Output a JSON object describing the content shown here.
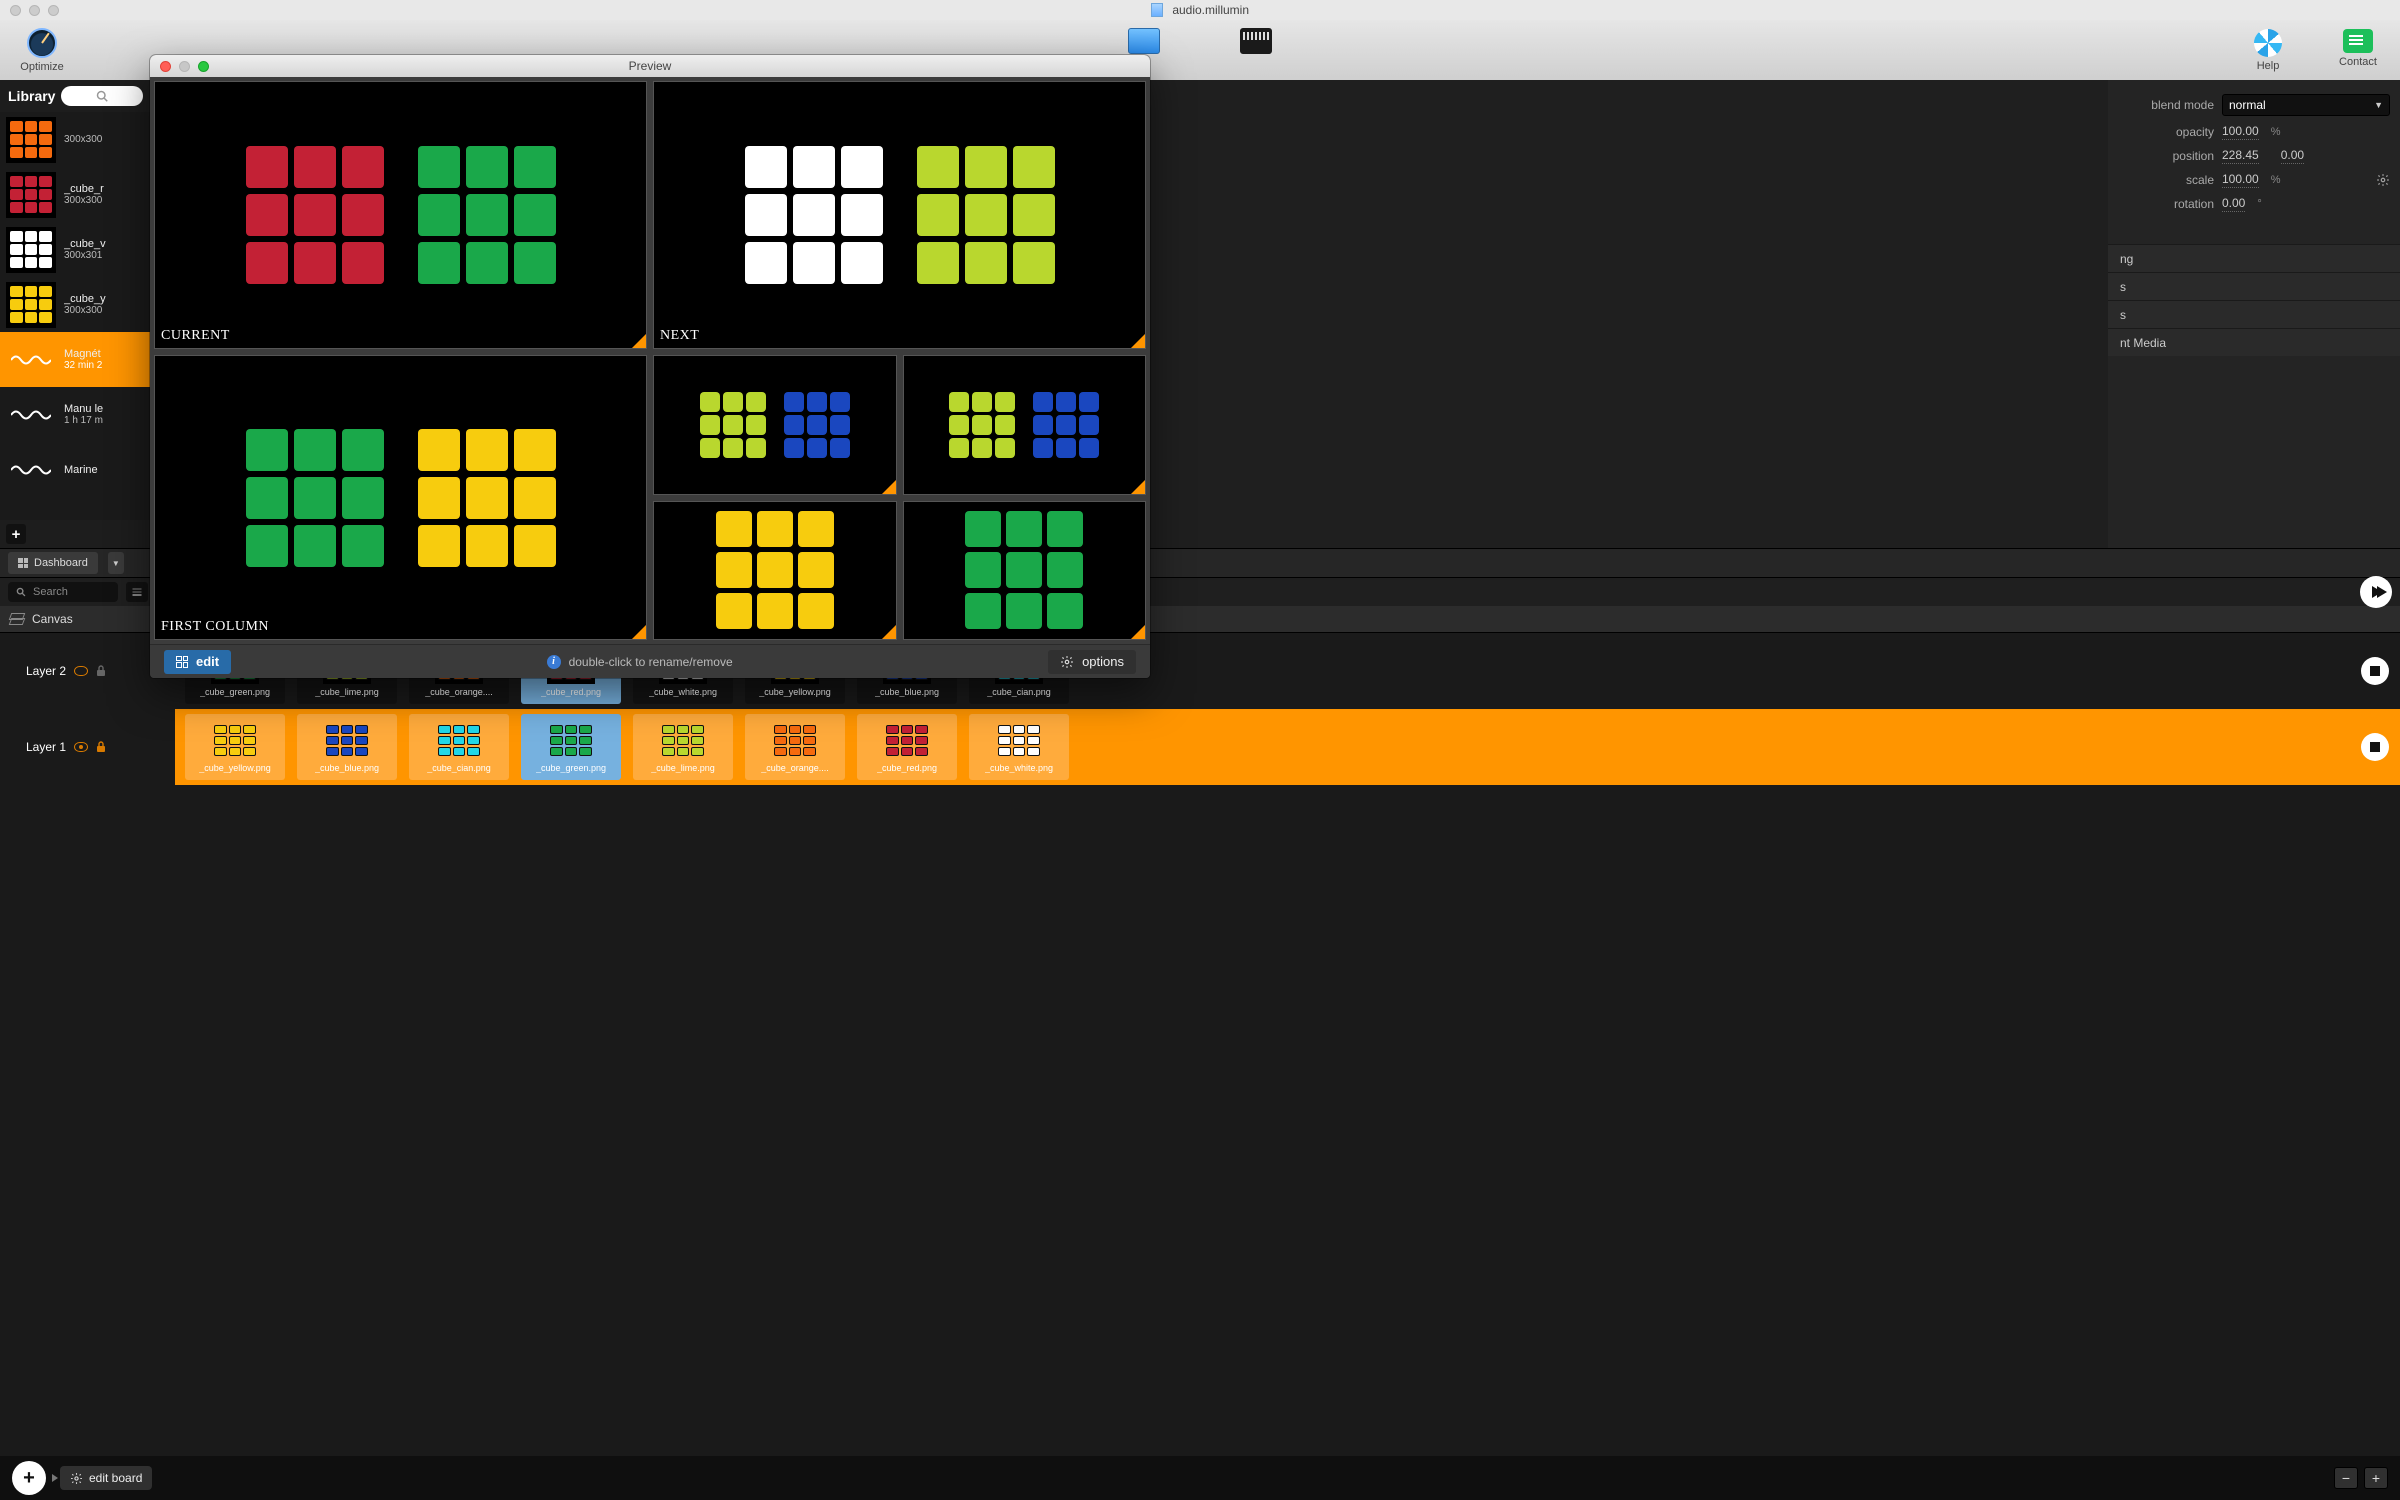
{
  "window_title": "audio.millumin",
  "toolbar": {
    "optimize": "Optimize",
    "help": "Help",
    "contact": "Contact"
  },
  "library": {
    "title": "Library",
    "items": [
      {
        "name": "",
        "sub": "300x300",
        "color": "#f56a0e"
      },
      {
        "name": "_cube_r",
        "sub": "300x300",
        "color": "#c32135"
      },
      {
        "name": "_cube_v",
        "sub": "300x301",
        "color": "#ffffff"
      },
      {
        "name": "_cube_y",
        "sub": "300x300",
        "color": "#f7cc0e"
      },
      {
        "name": "Magnét",
        "sub": "32 min 2",
        "wave": true
      },
      {
        "name": "Manu le",
        "sub": "1 h  17 m",
        "wave": true
      },
      {
        "name": "Marine",
        "sub": "",
        "wave": true
      }
    ]
  },
  "props": {
    "blend_mode_label": "blend mode",
    "blend_mode_value": "normal",
    "opacity_label": "opacity",
    "opacity_value": "100.00",
    "opacity_unit": "%",
    "position_label": "position",
    "position_x": "228.45",
    "position_y": "0.00",
    "scale_label": "scale",
    "scale_value": "100.00",
    "scale_unit": "%",
    "rotation_label": "rotation",
    "rotation_value": "0.00",
    "rotation_unit": "°",
    "sections": [
      "ng",
      "s",
      "s",
      "nt Media"
    ]
  },
  "dashboard_tab": "Dashboard",
  "search_placeholder": "Search",
  "canvas_label": "Canvas",
  "layers": [
    {
      "name": "Layer 2",
      "selected": false,
      "clips": [
        {
          "label": "_cube_green.png",
          "color": "#1aa84a"
        },
        {
          "label": "_cube_lime.png",
          "color": "#b9d72e"
        },
        {
          "label": "_cube_orange....",
          "color": "#f56a0e"
        },
        {
          "label": "_cube_red.png",
          "color": "#c32135",
          "selected": true
        },
        {
          "label": "_cube_white.png",
          "color": "#ffffff"
        },
        {
          "label": "_cube_yellow.png",
          "color": "#f7cc0e"
        },
        {
          "label": "_cube_blue.png",
          "color": "#1a47bf"
        },
        {
          "label": "_cube_cian.png",
          "color": "#21d7e8"
        }
      ]
    },
    {
      "name": "Layer 1",
      "selected": true,
      "clips": [
        {
          "label": "_cube_yellow.png",
          "color": "#f7cc0e"
        },
        {
          "label": "_cube_blue.png",
          "color": "#1a47bf"
        },
        {
          "label": "_cube_cian.png",
          "color": "#21d7e8"
        },
        {
          "label": "_cube_green.png",
          "color": "#1aa84a",
          "selected": true
        },
        {
          "label": "_cube_lime.png",
          "color": "#b9d72e"
        },
        {
          "label": "_cube_orange....",
          "color": "#f56a0e"
        },
        {
          "label": "_cube_red.png",
          "color": "#c32135"
        },
        {
          "label": "_cube_white.png",
          "color": "#ffffff"
        }
      ]
    }
  ],
  "edit_board": "edit board",
  "preview": {
    "title": "Preview",
    "labels": {
      "current": "CURRENT",
      "next": "NEXT",
      "first": "FIRST COLUMN"
    },
    "edit": "edit",
    "options": "options",
    "hint": "double-click to rename/remove",
    "panes": {
      "current": [
        "#c32135",
        "#1aa84a"
      ],
      "next": [
        "#ffffff",
        "#b9d72e"
      ],
      "first": [
        "#1aa84a",
        "#f7cc0e"
      ],
      "sub": [
        [
          [
            "#b9d72e",
            "#1a47bf"
          ],
          "small"
        ],
        [
          [
            "#b9d72e",
            "#1a47bf"
          ],
          "small"
        ],
        [
          [
            "#f7cc0e"
          ],
          "big"
        ],
        [
          [
            "#1aa84a"
          ],
          "big"
        ]
      ]
    }
  }
}
